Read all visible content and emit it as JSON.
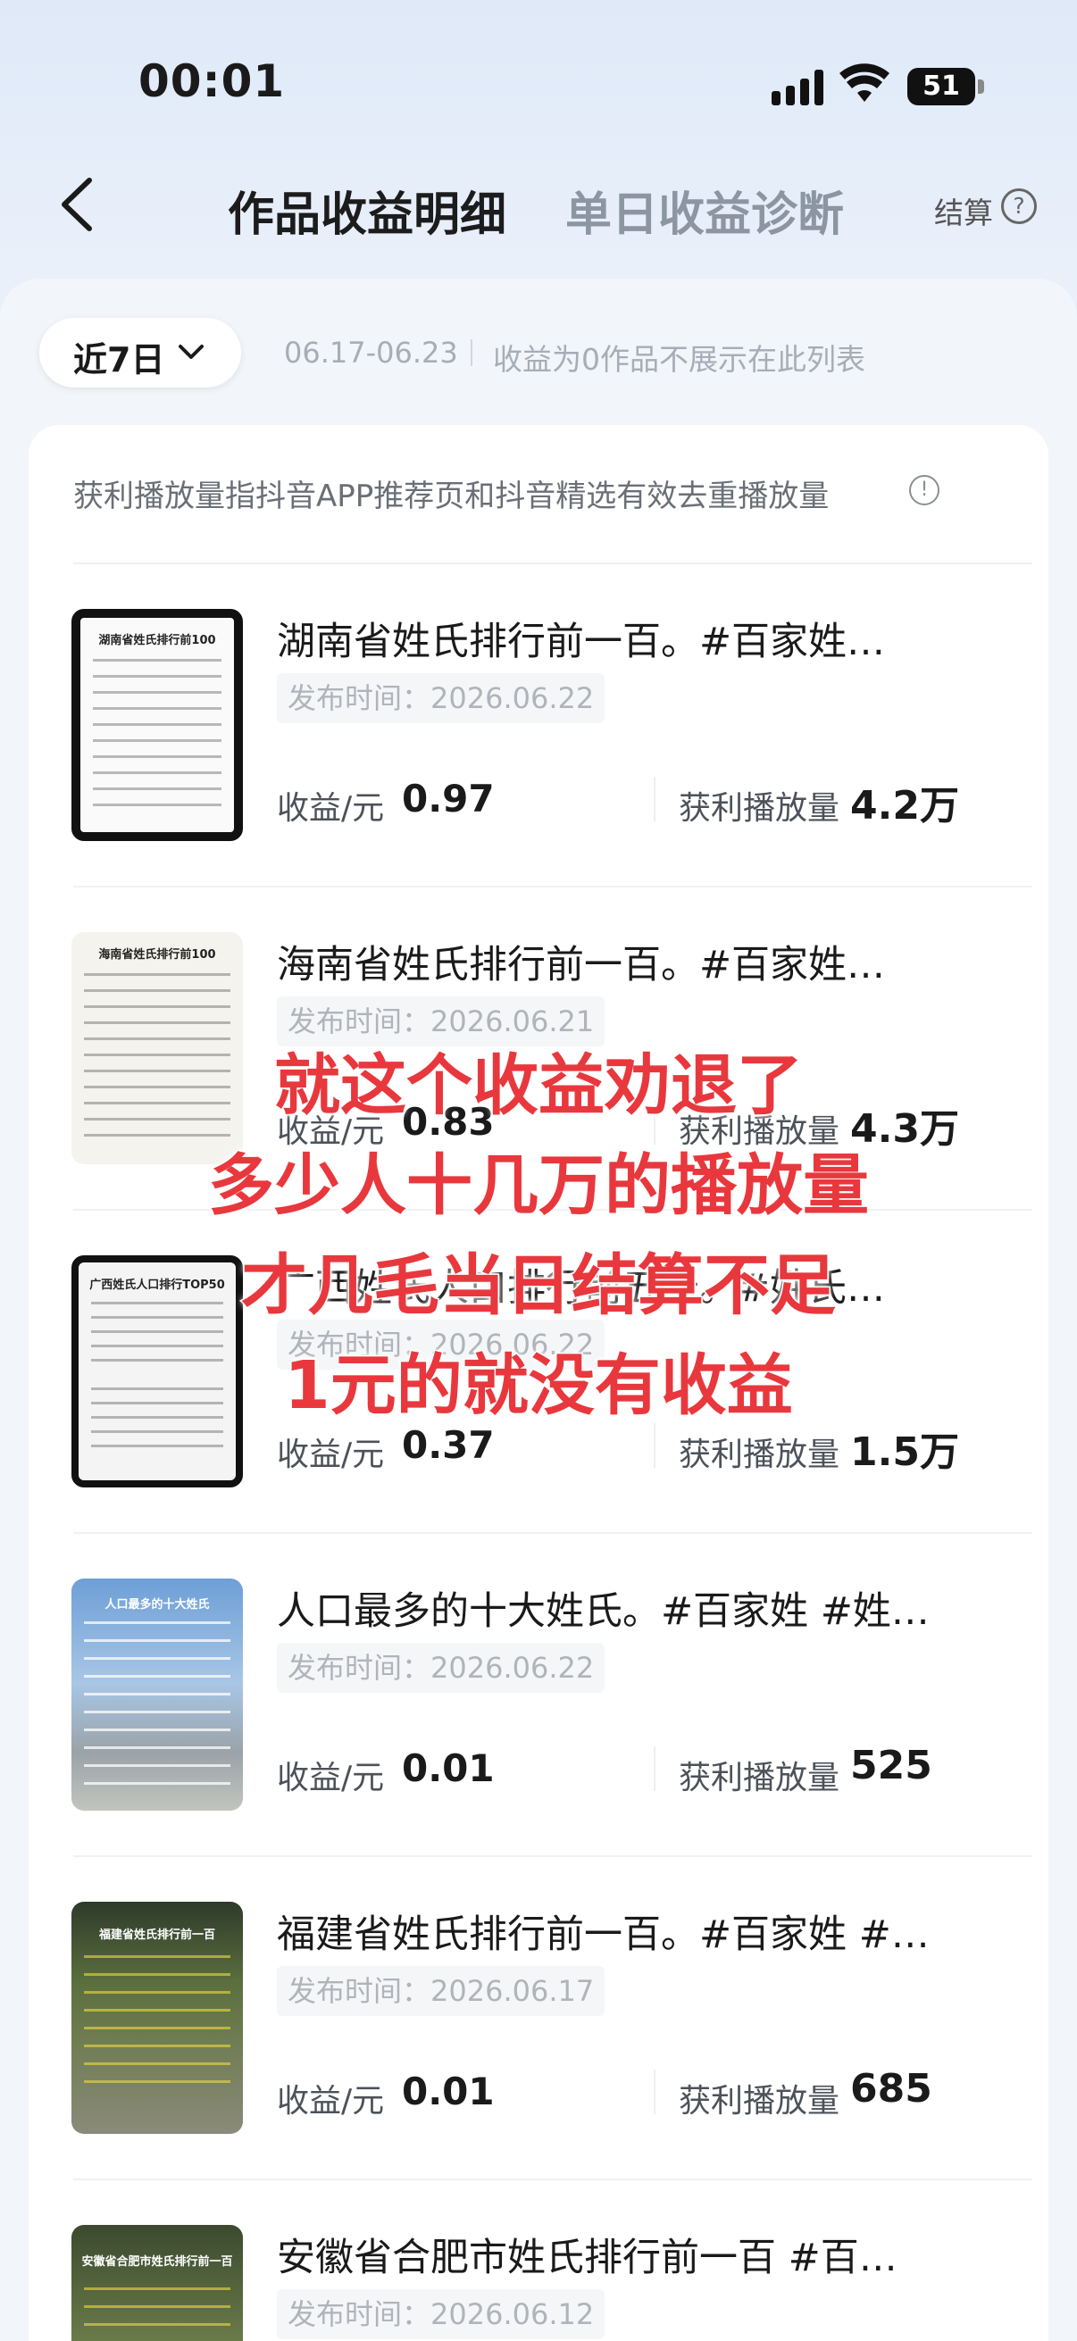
{
  "status_bar": {
    "time": "00:01",
    "battery": "51"
  },
  "nav": {
    "tab_active": "作品收益明细",
    "tab_inactive": "单日收益诊断",
    "settle_label": "结算",
    "help_glyph": "?"
  },
  "filter": {
    "range_label": "近7日",
    "date_range": "06.17-06.23",
    "notice": "收益为0作品不展示在此列表"
  },
  "card_note": "获利播放量指抖音APP推荐页和抖音精选有效去重播放量",
  "info_glyph": "!",
  "labels": {
    "earn": "收益/元",
    "play": "获利播放量"
  },
  "rows": [
    {
      "title": "湖南省姓氏排行前一百。#百家姓…",
      "pub": "发布时间：2026.06.22",
      "earn": "0.97",
      "play": "4.2万",
      "thumb_title": "湖南省姓氏排行前100"
    },
    {
      "title": "海南省姓氏排行前一百。#百家姓…",
      "pub": "发布时间：2026.06.21",
      "earn": "0.83",
      "play": "4.3万",
      "thumb_title": "海南省姓氏排行前100"
    },
    {
      "title": "广西姓氏人口排行前五十。#姓氏…",
      "pub": "发布时间：2026.06.22",
      "earn": "0.37",
      "play": "1.5万",
      "thumb_title": "广西姓氏人口排行TOP50"
    },
    {
      "title": "人口最多的十大姓氏。#百家姓 #姓…",
      "pub": "发布时间：2026.06.22",
      "earn": "0.01",
      "play": "525",
      "thumb_title": "人口最多的十大姓氏"
    },
    {
      "title": "福建省姓氏排行前一百。#百家姓 #…",
      "pub": "发布时间：2026.06.17",
      "earn": "0.01",
      "play": "685",
      "thumb_title": "福建省姓氏排行前一百"
    },
    {
      "title": "安徽省合肥市姓氏排行前一百 #百…",
      "pub": "发布时间：2026.06.12",
      "earn": "",
      "play": "",
      "thumb_title": "安徽省合肥市姓氏排行前一百"
    }
  ],
  "overlay": [
    "就这个收益劝退了",
    "多少人十几万的播放量",
    "才几毛当日结算不足",
    "1元的就没有收益"
  ],
  "colors": {
    "overlay_text": "#e8383d",
    "accent_text": "#1a1a1a",
    "muted": "#a7adb6"
  }
}
